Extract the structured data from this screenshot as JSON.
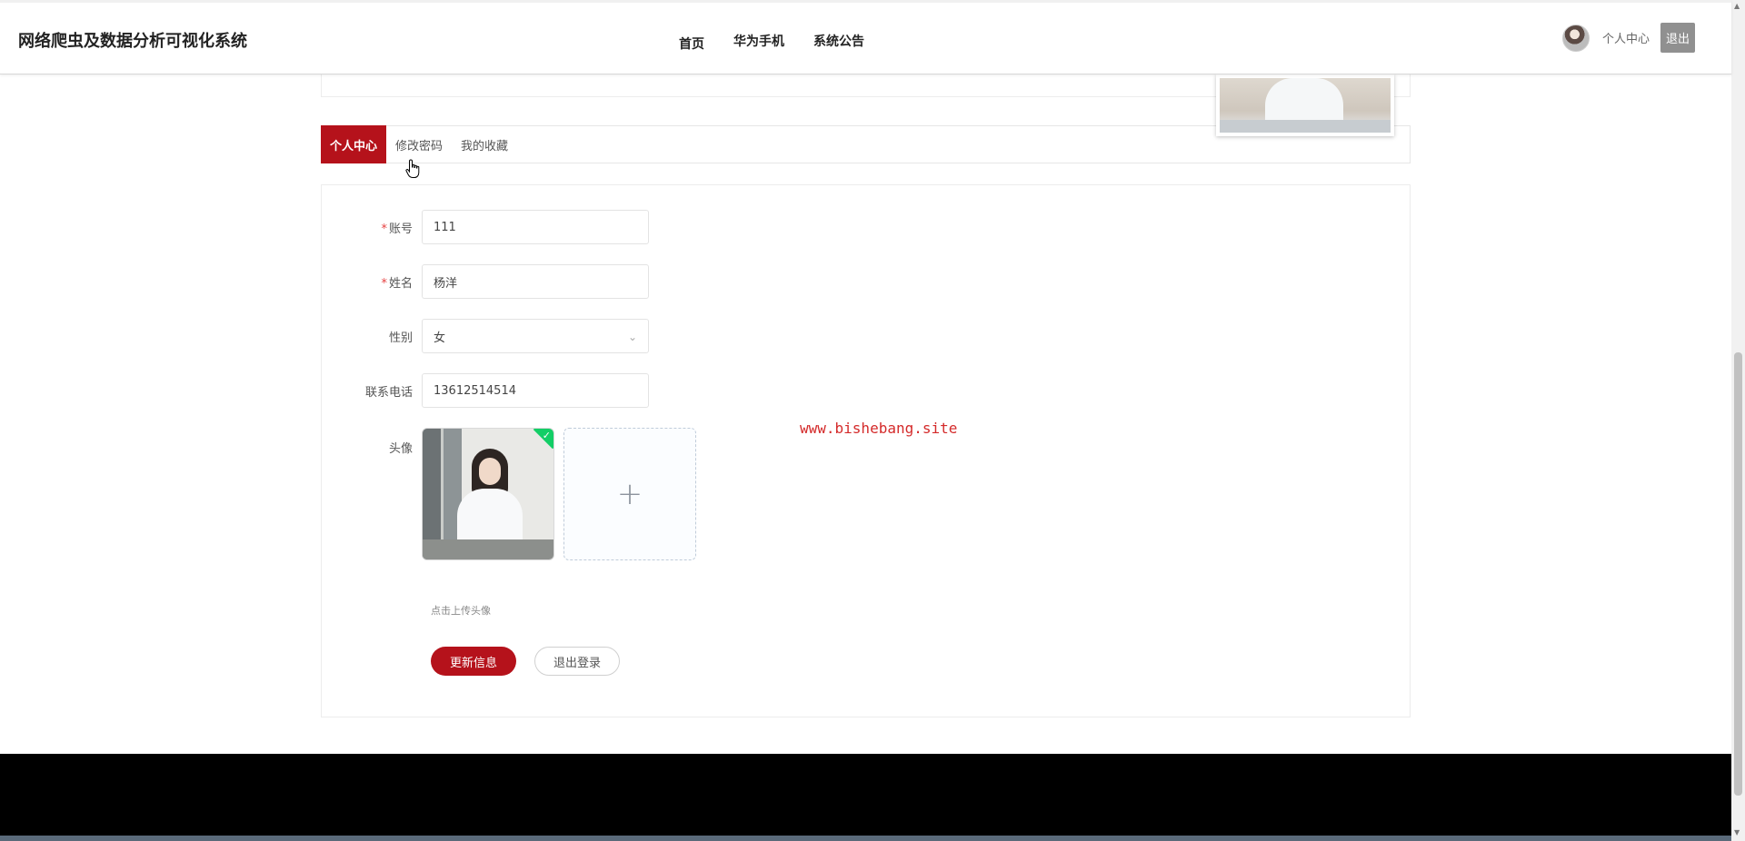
{
  "app": {
    "title": "网络爬虫及数据分析可视化系统"
  },
  "nav": {
    "items": [
      "首页",
      "华为手机",
      "系统公告"
    ]
  },
  "user": {
    "center_label": "个人中心",
    "logout_label": "退出"
  },
  "tabs": {
    "items": [
      "个人中心",
      "修改密码",
      "我的收藏"
    ],
    "active": "个人中心"
  },
  "form": {
    "account": {
      "label": "账号",
      "value": "111",
      "required": true
    },
    "name": {
      "label": "姓名",
      "value": "杨洋",
      "required": true
    },
    "gender": {
      "label": "性别",
      "value": "女"
    },
    "phone": {
      "label": "联系电话",
      "value": "13612514514"
    },
    "avatar": {
      "label": "头像",
      "hint": "点击上传头像"
    },
    "required_mark": "*",
    "plus_glyph": "+",
    "check_glyph": "✓",
    "chevron_glyph": "⌄"
  },
  "actions": {
    "update_label": "更新信息",
    "logout_label": "退出登录"
  },
  "watermark": "www.bishebang.site",
  "colors": {
    "accent": "#b5121b",
    "success": "#13ce66",
    "watermark": "#d42a2a"
  }
}
